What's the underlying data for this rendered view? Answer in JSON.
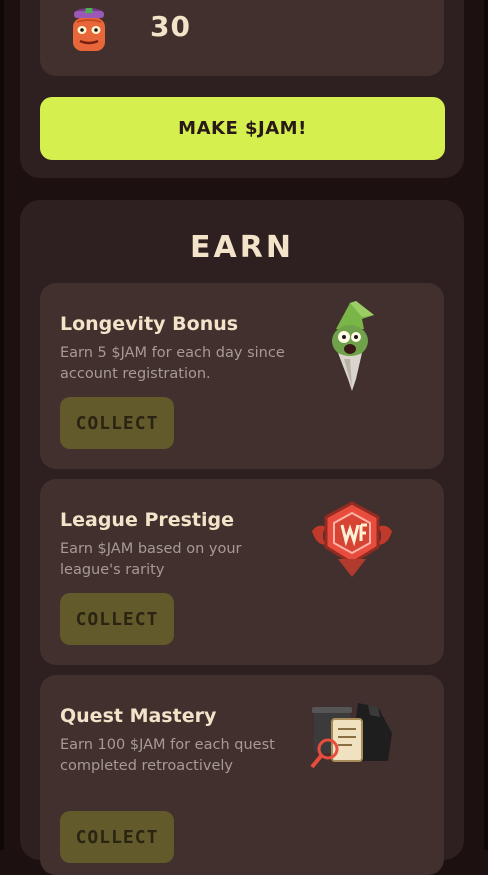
{
  "balance": {
    "value": "30"
  },
  "make_jam": {
    "label": "MAKE $JAM!"
  },
  "earn": {
    "title": "EARN",
    "cards": [
      {
        "title": "Longevity Bonus",
        "description": "Earn 5 $JAM for each day since account registration.",
        "button": "COLLECT",
        "icon": "wizard-icon"
      },
      {
        "title": "League Prestige",
        "description": "Earn $JAM based on your league's rarity",
        "button": "COLLECT",
        "icon": "league-badge-icon"
      },
      {
        "title": "Quest Mastery",
        "description": "Earn 100 $JAM for each quest completed retroactively",
        "button": "COLLECT",
        "icon": "quest-scroll-icon"
      }
    ]
  }
}
